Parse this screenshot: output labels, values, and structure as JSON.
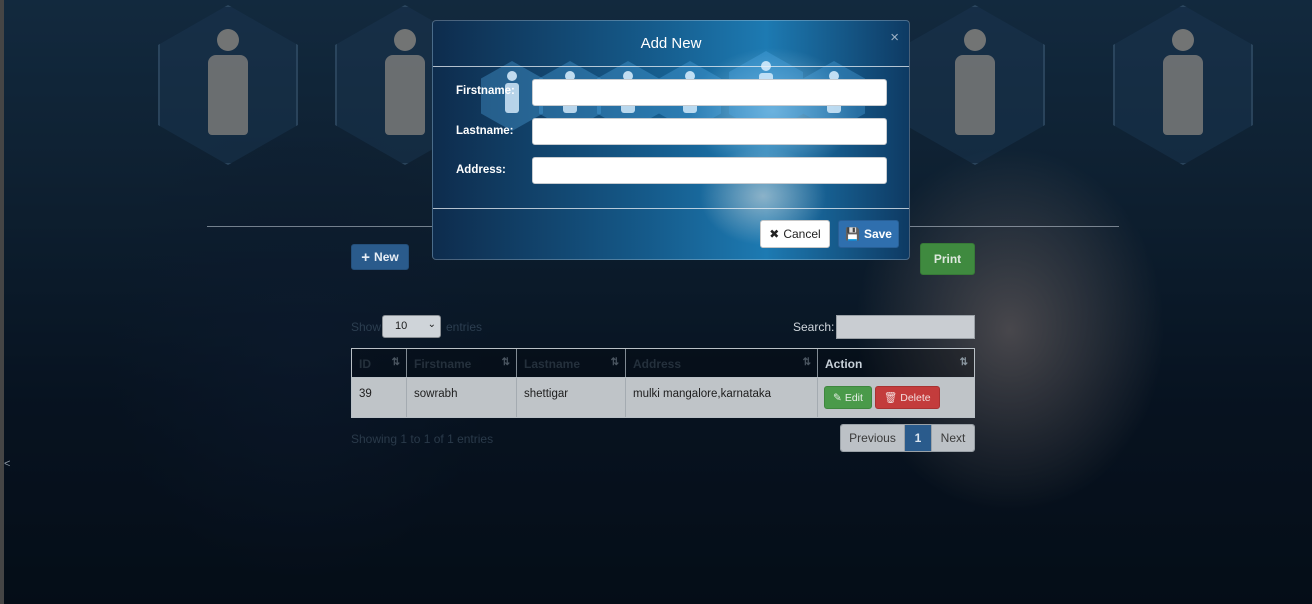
{
  "page": {
    "new_button": "New",
    "print_button": "Print",
    "show_label": "Show",
    "entries_label": "entries",
    "page_size": "10",
    "search_label": "Search:",
    "left_arrow": "<"
  },
  "table": {
    "headers": [
      "ID",
      "Firstname",
      "Lastname",
      "Address",
      "Action"
    ],
    "rows": [
      {
        "id": "39",
        "firstname": "sowrabh",
        "lastname": "shettigar",
        "address": "mulki mangalore,karnataka",
        "edit": "Edit",
        "delete": "Delete"
      }
    ],
    "info": "Showing 1 to 1 of 1 entries"
  },
  "pagination": {
    "previous": "Previous",
    "current": "1",
    "next": "Next"
  },
  "modal": {
    "title": "Add New",
    "close": "×",
    "fields": [
      {
        "label": "Firstname:",
        "value": ""
      },
      {
        "label": "Lastname:",
        "value": ""
      },
      {
        "label": "Address:",
        "value": ""
      }
    ],
    "cancel_button": "Cancel",
    "save_button": "Save"
  },
  "icons": {
    "new": "plus-icon",
    "cancel": "x-icon",
    "save": "floppy-disk-icon",
    "edit": "pencil-square-icon",
    "delete": "trash-icon",
    "sort": "sort-icon"
  },
  "colors": {
    "primary": "#2f6fae",
    "success": "#3f8a3f",
    "danger": "#c33c3c",
    "modal_bg": "#155a8a"
  }
}
